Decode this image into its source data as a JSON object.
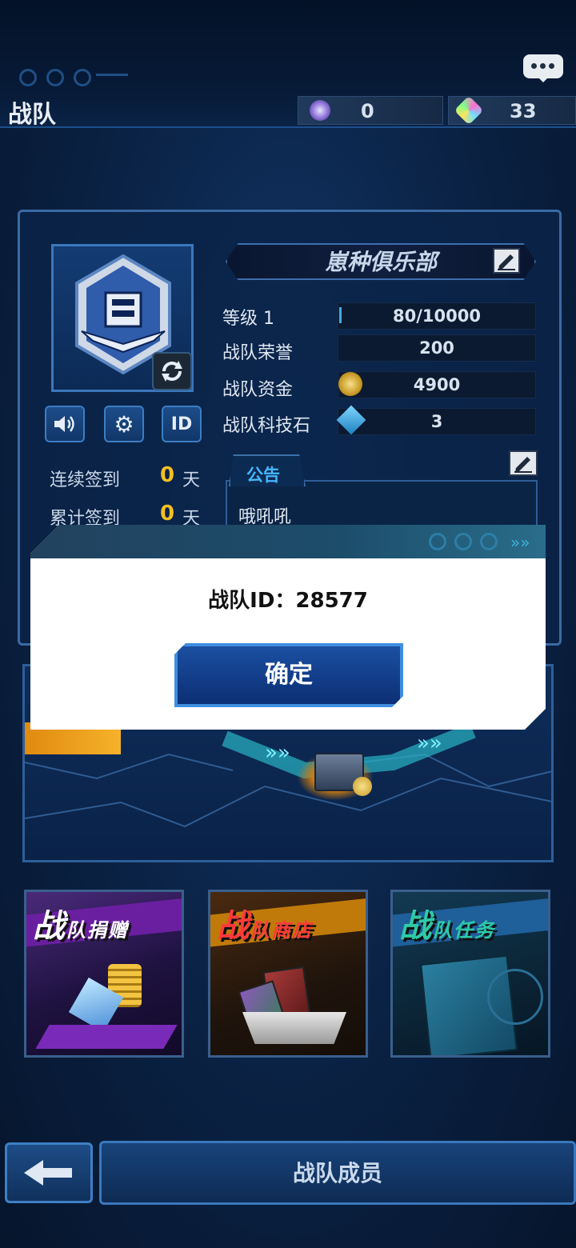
{
  "header": {
    "title": "战队",
    "currency_a": {
      "value": "0",
      "icon": "purple-orb-icon"
    },
    "currency_b": {
      "value": "33",
      "icon": "crystal-gem-icon"
    }
  },
  "team": {
    "name": "崽种俱乐部",
    "stats": [
      {
        "label": "等级  1",
        "value": "80/10000",
        "progress": 0.008
      },
      {
        "label": "战队荣誉",
        "value": "200"
      },
      {
        "label": "战队资金",
        "value": "4900",
        "icon": "coin-icon"
      },
      {
        "label": "战队科技石",
        "value": "3",
        "icon": "tech-stone-icon"
      }
    ],
    "buttons": {
      "id_label": "ID"
    }
  },
  "signin": {
    "consecutive": {
      "label": "连续签到",
      "value": "0",
      "unit": "天"
    },
    "total": {
      "label": "累计签到",
      "value": "0",
      "unit": "天"
    }
  },
  "notice": {
    "title": "公告",
    "text": "哦吼吼"
  },
  "tiles": [
    {
      "label": "战队捐赠",
      "prefix": "战",
      "suffix": "队捐赠",
      "color": "#6a1fa0"
    },
    {
      "label": "战队商店",
      "prefix": "战",
      "suffix": "队商店",
      "color": "#c07a0a"
    },
    {
      "label": "战队任务",
      "prefix": "战",
      "suffix": "队任务",
      "color": "#1f7a8a"
    }
  ],
  "footer": {
    "members_label": "战队成员"
  },
  "dialog": {
    "message": "战队ID：28577",
    "confirm_label": "确定"
  }
}
